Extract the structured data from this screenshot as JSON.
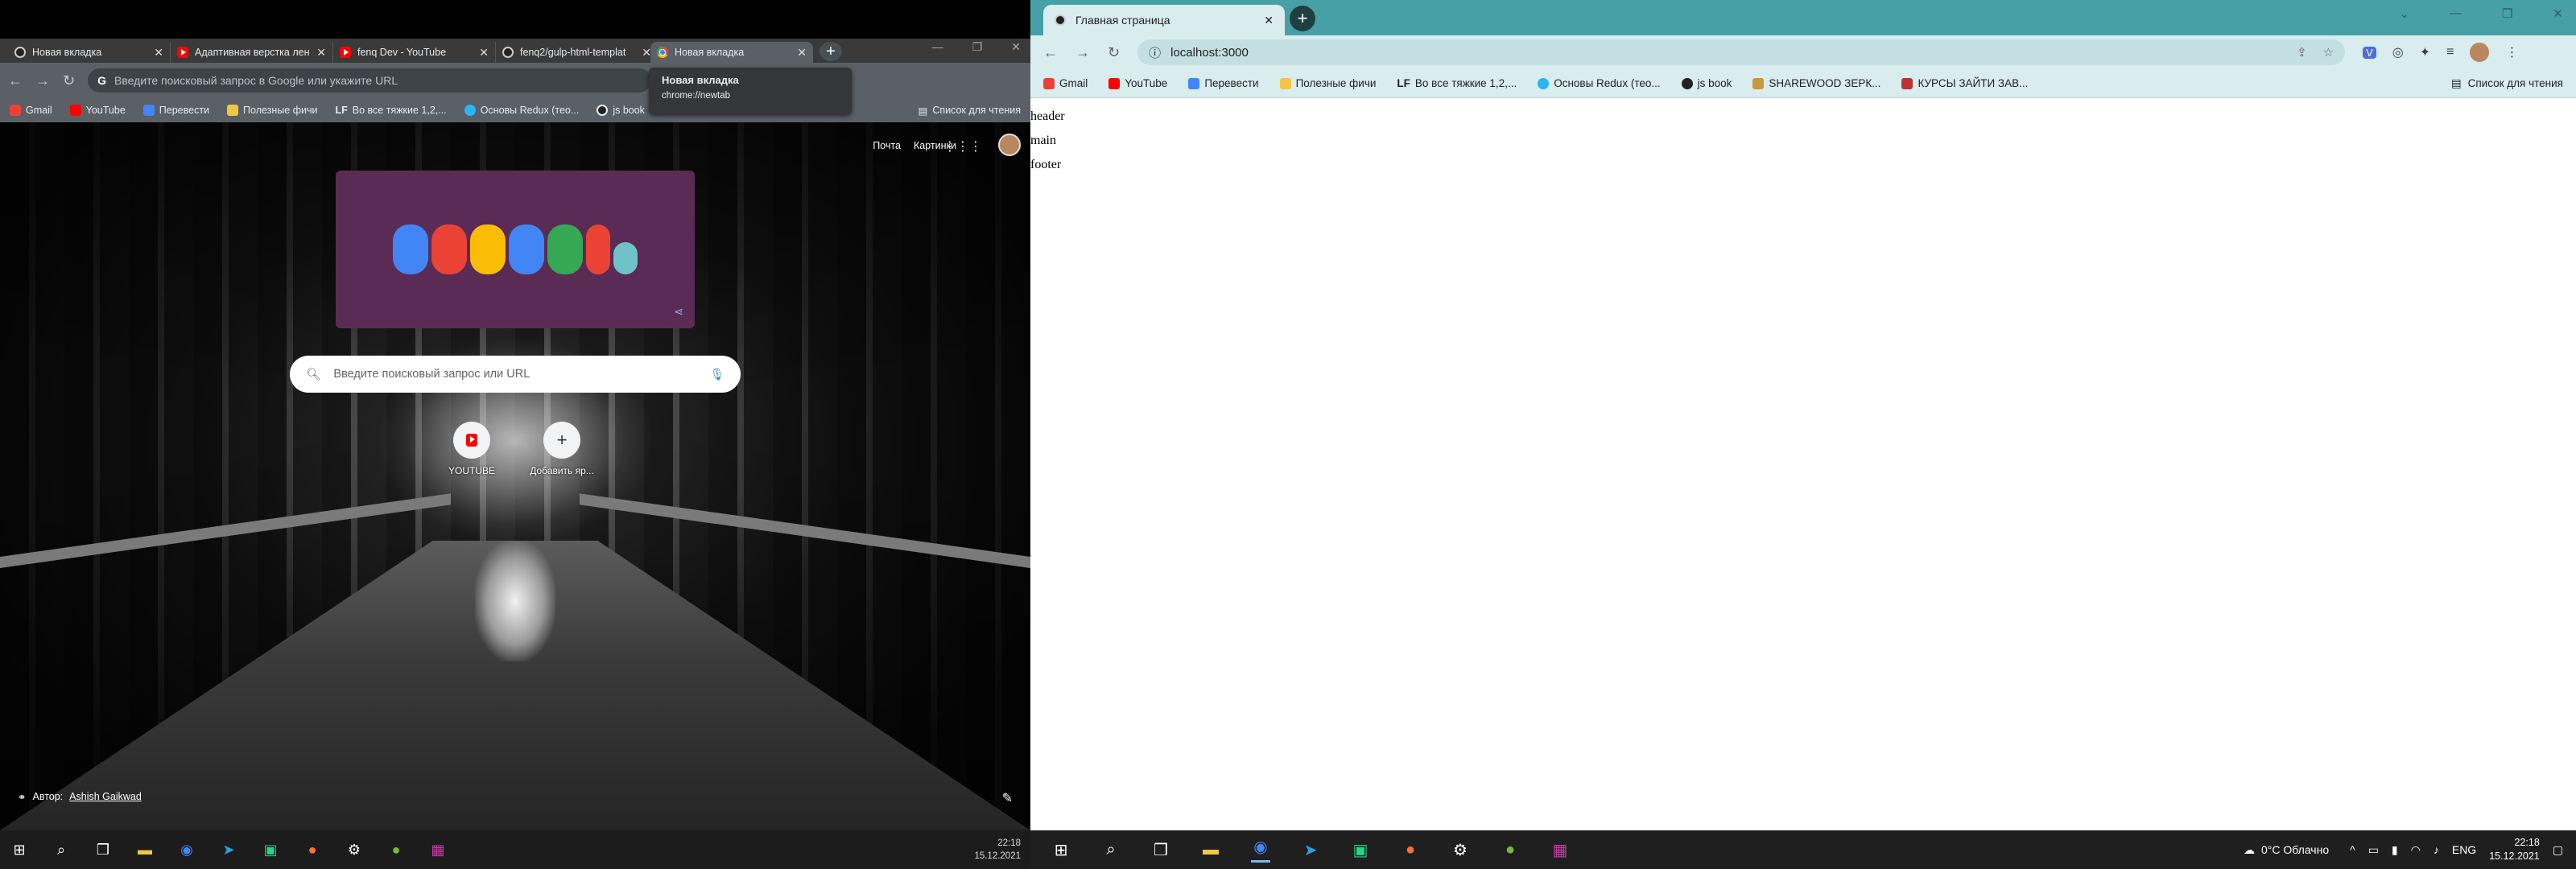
{
  "left": {
    "tabs": [
      {
        "title": "Новая вкладка",
        "favicon": "github-icon"
      },
      {
        "title": "Адаптивная верстка лен",
        "favicon": "youtube-icon"
      },
      {
        "title": "fenq Dev - YouTube",
        "favicon": "youtube-icon"
      },
      {
        "title": "fenq2/gulp-html-templat",
        "favicon": "github-icon"
      },
      {
        "title": "Новая вкладка",
        "favicon": "chrome-icon",
        "active": true
      }
    ],
    "omnibox_placeholder": "Введите поисковый запрос в Google или укажите URL",
    "bookmarks": [
      "Gmail",
      "YouTube",
      "Перевести",
      "Полезные фичи",
      "Во все тяжкие 1,2,...",
      "Основы Redux (тео...",
      "js book"
    ],
    "reading_list": "Список для чтения",
    "tooltip": {
      "title": "Новая вкладка",
      "url": "chrome://newtab"
    },
    "ntp": {
      "top_links": [
        "Почта",
        "Картинки"
      ],
      "search_placeholder": "Введите поисковый запрос или URL",
      "shortcuts": [
        {
          "label": "YOUTUBE",
          "icon": "youtube-icon"
        },
        {
          "label": "Добавить яр...",
          "icon": "plus-icon"
        }
      ],
      "author_prefix": "Автор:",
      "author_name": "Ashish Gaikwad"
    },
    "taskbar_clock": {
      "time": "22:18",
      "date": "15.12.2021"
    }
  },
  "right": {
    "tab_title": "Главная страница",
    "url": "localhost:3000",
    "bookmarks": [
      "Gmail",
      "YouTube",
      "Перевести",
      "Полезные фичи",
      "Во все тяжкие 1,2,...",
      "Основы Redux (тео...",
      "js book",
      "SHAREWOOD ЗЕРК...",
      "КУРСЫ ЗАЙТИ ЗАВ..."
    ],
    "reading_list": "Список для чтения",
    "page_lines": [
      "header",
      "main",
      "footer"
    ],
    "weather": "0°C Облачно",
    "lang": "ENG",
    "clock": {
      "time": "22:18",
      "date": "15.12.2021"
    }
  },
  "colors": {
    "right_frame": "#47a0a6",
    "right_toolbar": "#d9ecee",
    "doodle_bg": "#5a2b55"
  }
}
